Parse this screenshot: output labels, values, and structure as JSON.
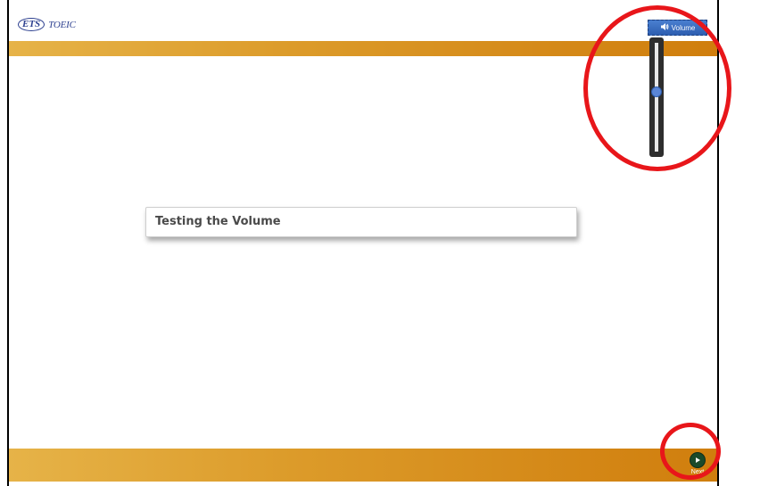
{
  "header": {
    "logo_ets": "ETS",
    "logo_toeic": "TOEIC"
  },
  "volume": {
    "label": "Volume",
    "icon": "speaker-icon",
    "level_fraction": 0.55
  },
  "main": {
    "title": "Testing the Volume"
  },
  "footer": {
    "next_label": "Next",
    "next_icon": "play-icon"
  },
  "colors": {
    "bar_start": "#e6b348",
    "bar_end": "#d07e0d",
    "volume_button": "#2d5eb0",
    "annotation": "#e8161a",
    "next_button": "#1a4a2a"
  }
}
